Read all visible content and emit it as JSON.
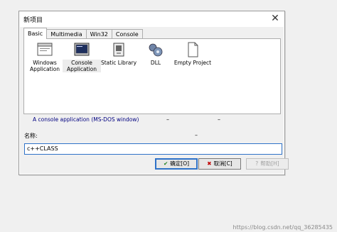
{
  "dialog": {
    "title": "新项目"
  },
  "tabs": [
    {
      "label": "Basic",
      "active": true
    },
    {
      "label": "Multimedia",
      "active": false
    },
    {
      "label": "Win32",
      "active": false
    },
    {
      "label": "Console",
      "active": false
    }
  ],
  "items": [
    {
      "label1": "Windows",
      "label2": "Application",
      "icon": "window-app-icon"
    },
    {
      "label1": "Console",
      "label2": "Application",
      "icon": "console-app-icon",
      "selected": true
    },
    {
      "label1": "Static Library",
      "label2": "",
      "icon": "static-library-icon"
    },
    {
      "label1": "DLL",
      "label2": "",
      "icon": "dll-icon"
    },
    {
      "label1": "Empty Project",
      "label2": "",
      "icon": "empty-project-icon"
    }
  ],
  "description": "A console application (MS-DOS window)",
  "name_label": "名称:",
  "name_value": "c++CLASS",
  "buttons": {
    "ok": "确定[O]",
    "cancel": "取消[C]",
    "help": "帮助[H]"
  },
  "watermark": "https://blog.csdn.net/qq_36285435"
}
